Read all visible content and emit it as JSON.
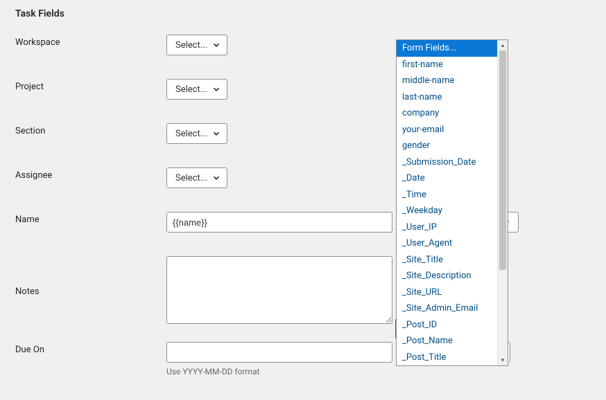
{
  "section_title": "Task Fields",
  "fields": {
    "workspace": {
      "label": "Workspace",
      "select": "Select..."
    },
    "project": {
      "label": "Project",
      "select": "Select..."
    },
    "section": {
      "label": "Section",
      "select": "Select..."
    },
    "assignee": {
      "label": "Assignee",
      "select": "Select..."
    },
    "name": {
      "label": "Name",
      "value": "{{name}}"
    },
    "notes": {
      "label": "Notes",
      "value": ""
    },
    "dueon": {
      "label": "Due On",
      "value": "",
      "helper": "Use YYYY-MM-DD format"
    }
  },
  "form_fields_label": "Form Fields...",
  "dropdown": {
    "header": "Form Fields...",
    "items": [
      "first-name",
      "middle-name",
      "last-name",
      "company",
      "your-email",
      "gender",
      "_Submission_Date",
      "_Date",
      "_Time",
      "_Weekday",
      "_User_IP",
      "_User_Agent",
      "_Site_Title",
      "_Site_Description",
      "_Site_URL",
      "_Site_Admin_Email",
      "_Post_ID",
      "_Post_Name",
      "_Post_Title"
    ]
  }
}
